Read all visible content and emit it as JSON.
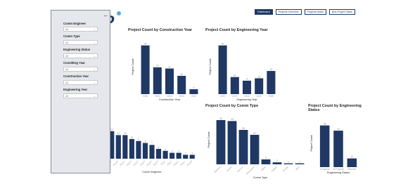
{
  "nav": {
    "buttons": [
      {
        "label": "Dashboard",
        "active": true
      },
      {
        "label": "Projects Overview",
        "active": false
      },
      {
        "label": "Projects Detail",
        "active": false
      },
      {
        "label": "Non-Project Tasks",
        "active": false
      }
    ]
  },
  "logo": {
    "text": "o"
  },
  "filters": {
    "back_icon": "←",
    "items": [
      {
        "label": "Comm Engineer",
        "value": "All"
      },
      {
        "label": "Comm Type",
        "value": "All"
      },
      {
        "label": "Engineering Status",
        "value": "All"
      },
      {
        "label": "Const/Eng Year",
        "value": "All"
      },
      {
        "label": "Construction Year",
        "value": "All"
      },
      {
        "label": "Engineering Year",
        "value": "All"
      }
    ]
  },
  "colors": {
    "bar": "#1f3864",
    "panel": "#e6e7ec",
    "accent": "#5aa7e0"
  },
  "chart_data": [
    {
      "type": "bar",
      "title": "Project Count by Construction Year",
      "xlabel": "Construction Year",
      "ylabel": "Project Count",
      "categories": [
        "2026",
        "2025",
        "2024",
        "2023",
        "2022"
      ],
      "values": [
        40,
        22,
        21,
        15,
        4
      ],
      "ylim": [
        0,
        45
      ]
    },
    {
      "type": "bar",
      "title": "Project Count by Engineering Year",
      "xlabel": "Engineering Year",
      "ylabel": "Project Count",
      "categories": [
        "2022",
        "2023",
        "2024",
        "2025",
        "2026"
      ],
      "values": [
        40,
        14,
        11,
        13,
        19
      ],
      "ylim": [
        0,
        45
      ]
    },
    {
      "type": "bar",
      "title": "Project Count by Comm Type",
      "xlabel": "Comm Type",
      "ylabel": "Project Count",
      "categories": [
        "Mainline",
        "Comm",
        "Service",
        "Relocation",
        "Other",
        "Capital",
        "Private",
        "Misc"
      ],
      "values": [
        45,
        44,
        35,
        30,
        5,
        2,
        1,
        1
      ],
      "ylim": [
        0,
        50
      ]
    },
    {
      "type": "bar",
      "title": "Project Count by Engineering Status",
      "xlabel": "Engineering Status",
      "ylabel": "Project Count",
      "categories": [
        "Complete",
        "In Progress",
        "Planned"
      ],
      "values": [
        48,
        42,
        10
      ],
      "ylim": [
        0,
        55
      ]
    },
    {
      "type": "bar",
      "title": "",
      "xlabel": "Comm Engineer",
      "ylabel": "",
      "categories": [
        "Eng A",
        "Eng B",
        "Eng C",
        "Eng D",
        "Eng E",
        "Eng F",
        "Eng G",
        "Eng H",
        "Eng I",
        "Eng J",
        "Eng K",
        "Eng L",
        "Eng M"
      ],
      "values": [
        14,
        12,
        12,
        10,
        9,
        8,
        7,
        5,
        4,
        3,
        3,
        2,
        2
      ],
      "ylim": [
        0,
        20
      ]
    }
  ]
}
